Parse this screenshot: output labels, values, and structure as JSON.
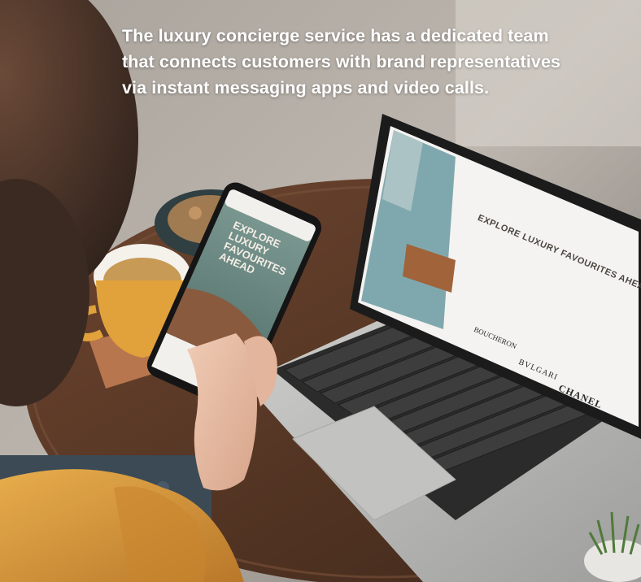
{
  "caption": {
    "line1": "The luxury concierge service has a dedicated team",
    "line2": "that connects customers with brand representatives",
    "line3": "via instant messaging apps and video calls."
  },
  "phone_screen": {
    "headline": "EXPLORE LUXURY FAVOURITES AHEAD"
  },
  "laptop_screen": {
    "headline": "EXPLORE LUXURY FAVOURITES AHEAD",
    "brands": [
      "BOUCHERON",
      "BVLGARI",
      "CHANEL"
    ]
  },
  "colors": {
    "caption_text": "#ffffff",
    "phone_screen_teal": "#5f7f7a",
    "laptop_body": "#b9b8b6",
    "table_wood": "#5a3a2a",
    "sweater": "#d99a3a"
  }
}
